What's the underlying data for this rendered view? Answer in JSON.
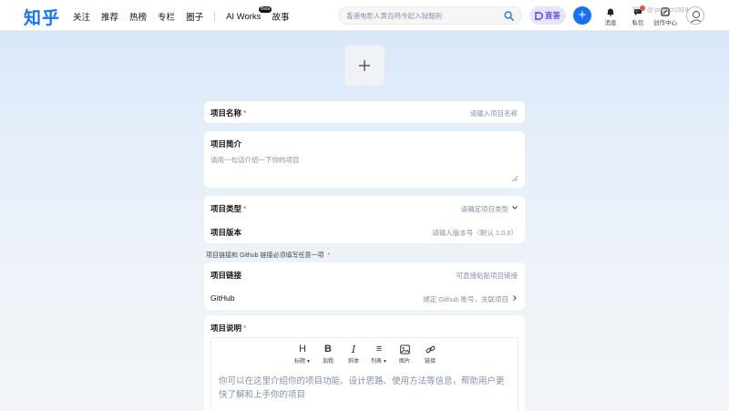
{
  "header": {
    "logo": "知乎",
    "nav": [
      "关注",
      "推荐",
      "热榜",
      "专栏",
      "圈子"
    ],
    "ai_works": "AI Works",
    "ai_works_badge": "Beta",
    "story": "故事",
    "search_placeholder": "香港电影人黄百鸣今起入狱服刑",
    "live_label": "直答",
    "icons": [
      {
        "name": "bell-icon",
        "label": "消息"
      },
      {
        "name": "chat-icon",
        "label": "私信"
      },
      {
        "name": "creator-icon",
        "label": "创作中心"
      }
    ],
    "watermark": "知乎 @ project1924"
  },
  "form": {
    "project_name": {
      "label": "项目名称",
      "placeholder": "请输入项目名称"
    },
    "project_intro": {
      "label": "项目简介",
      "placeholder": "请用一句话介绍一下你的项目"
    },
    "project_type": {
      "label": "项目类型",
      "placeholder": "请确定项目类型"
    },
    "project_version": {
      "label": "项目版本",
      "placeholder": "请输入版本号（默认 1.0.0）"
    },
    "links_note": "项目链接和 Github 链接必须填写任意一项",
    "project_link": {
      "label": "项目链接",
      "placeholder": "可直接粘贴项目链接"
    },
    "github": {
      "label": "GitHub",
      "placeholder": "绑定 Github 账号，关联项目"
    },
    "project_desc": {
      "label": "项目说明",
      "placeholder": "你可以在这里介绍你的项目功能、设计思路、使用方法等信息，帮助用户更快了解和上手你的项目"
    },
    "required_mark": "*"
  },
  "toolbar": [
    {
      "name": "heading",
      "glyph": "H",
      "label": "标题",
      "dropdown": true
    },
    {
      "name": "bold",
      "glyph": "B",
      "label": "加粗",
      "dropdown": false
    },
    {
      "name": "italic",
      "glyph": "I",
      "label": "斜体",
      "dropdown": false
    },
    {
      "name": "list",
      "glyph": "≡",
      "label": "列表",
      "dropdown": true
    },
    {
      "name": "image",
      "glyph": "",
      "label": "图片",
      "dropdown": false
    },
    {
      "name": "link",
      "glyph": "",
      "label": "链接",
      "dropdown": false
    }
  ],
  "colors": {
    "brand": "#1772f6",
    "required": "#f1403c",
    "placeholder": "#8590a6",
    "live": "#6b4fe6"
  }
}
